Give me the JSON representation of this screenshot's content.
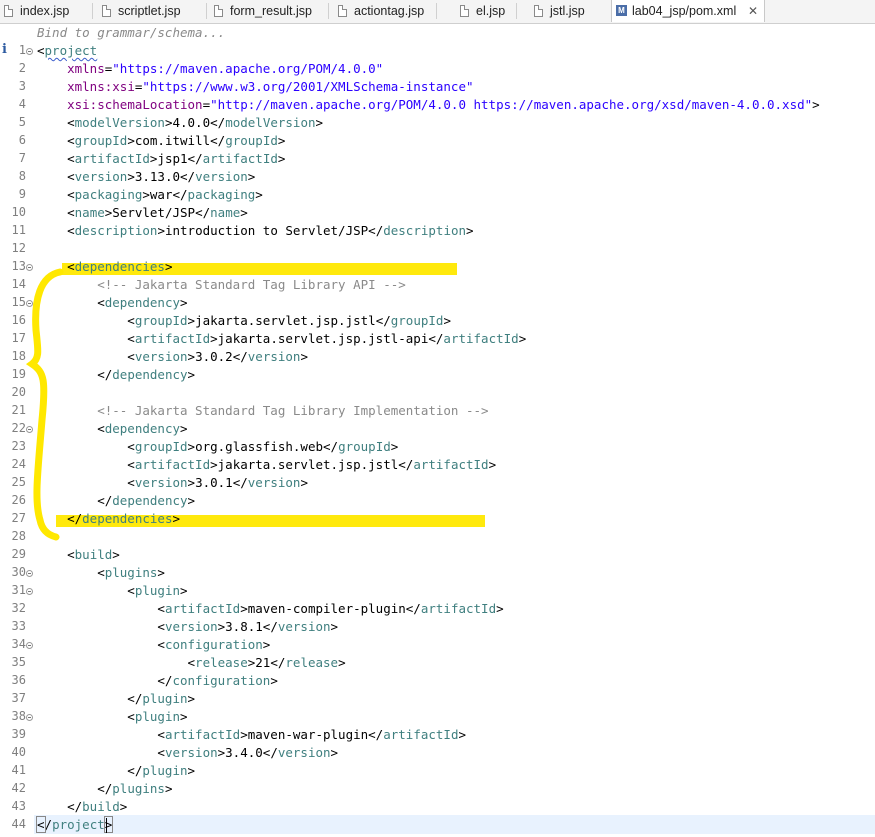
{
  "tabs": [
    {
      "label": "index.jsp"
    },
    {
      "label": "scriptlet.jsp"
    },
    {
      "label": "form_result.jsp"
    },
    {
      "label": "actiontag.jsp"
    },
    {
      "label": "el.jsp"
    },
    {
      "label": "jstl.jsp"
    },
    {
      "label": "lab04_jsp/pom.xml",
      "icon": "M",
      "active": true
    }
  ],
  "editor": {
    "hint": "Bind to grammar/schema...",
    "line_numbers": [
      "1",
      "2",
      "3",
      "4",
      "5",
      "6",
      "7",
      "8",
      "9",
      "10",
      "11",
      "12",
      "13",
      "14",
      "15",
      "16",
      "17",
      "18",
      "19",
      "20",
      "21",
      "22",
      "23",
      "24",
      "25",
      "26",
      "27",
      "28",
      "29",
      "30",
      "31",
      "32",
      "33",
      "34",
      "35",
      "36",
      "37",
      "38",
      "39",
      "40",
      "41",
      "42",
      "43",
      "44"
    ],
    "lines": {
      "l1": {
        "o": "<",
        "t": "project"
      },
      "l2": {
        "a": "xmlns",
        "eq": "=",
        "v": "\"https://maven.apache.org/POM/4.0.0\""
      },
      "l3": {
        "a": "xmlns:xsi",
        "eq": "=",
        "v": "\"https://www.w3.org/2001/XMLSchema-instance\""
      },
      "l4": {
        "a": "xsi:schemaLocation",
        "eq": "=",
        "v": "\"http://maven.apache.org/POM/4.0.0 https://maven.apache.org/xsd/maven-4.0.0.xsd\"",
        "close": ">"
      },
      "l5": {
        "t": "modelVersion",
        "text": "4.0.0"
      },
      "l6": {
        "t": "groupId",
        "text": "com.itwill"
      },
      "l7": {
        "t": "artifactId",
        "text": "jsp1"
      },
      "l8": {
        "t": "version",
        "text": "3.13.0"
      },
      "l9": {
        "t": "packaging",
        "text": "war"
      },
      "l10": {
        "t": "name",
        "text": "Servlet/JSP"
      },
      "l11": {
        "t": "description",
        "text": "introduction to Servlet/JSP"
      },
      "l13": {
        "t": "dependencies"
      },
      "l14": {
        "c": "<!-- Jakarta Standard Tag Library API -->"
      },
      "l15": {
        "t": "dependency"
      },
      "l16": {
        "t": "groupId",
        "text": "jakarta.servlet.jsp.jstl"
      },
      "l17": {
        "t": "artifactId",
        "text": "jakarta.servlet.jsp.jstl-api"
      },
      "l18": {
        "t": "version",
        "text": "3.0.2"
      },
      "l19": {
        "t": "dependency"
      },
      "l21": {
        "c": "<!-- Jakarta Standard Tag Library Implementation -->"
      },
      "l22": {
        "t": "dependency"
      },
      "l23": {
        "t": "groupId",
        "text": "org.glassfish.web"
      },
      "l24": {
        "t": "artifactId",
        "text": "jakarta.servlet.jsp.jstl"
      },
      "l25": {
        "t": "version",
        "text": "3.0.1"
      },
      "l26": {
        "t": "dependency"
      },
      "l27": {
        "t": "dependencies"
      },
      "l29": {
        "t": "build"
      },
      "l30": {
        "t": "plugins"
      },
      "l31": {
        "t": "plugin"
      },
      "l32": {
        "t": "artifactId",
        "text": "maven-compiler-plugin"
      },
      "l33": {
        "t": "version",
        "text": "3.8.1"
      },
      "l34": {
        "t": "configuration"
      },
      "l35": {
        "t": "release",
        "text": "21"
      },
      "l36": {
        "t": "configuration"
      },
      "l37": {
        "t": "plugin"
      },
      "l38": {
        "t": "plugin"
      },
      "l39": {
        "t": "artifactId",
        "text": "maven-war-plugin"
      },
      "l40": {
        "t": "version",
        "text": "3.4.0"
      },
      "l41": {
        "t": "plugin"
      },
      "l42": {
        "t": "plugins"
      },
      "l43": {
        "t": "build"
      },
      "l44": {
        "t": "project"
      }
    }
  },
  "colors": {
    "tag": "#3f7f7f",
    "attribute": "#7f007f",
    "value": "#2a00ff",
    "comment": "#8a8a8a",
    "highlight": "#ffe800",
    "current_line": "#e8f2fe"
  }
}
